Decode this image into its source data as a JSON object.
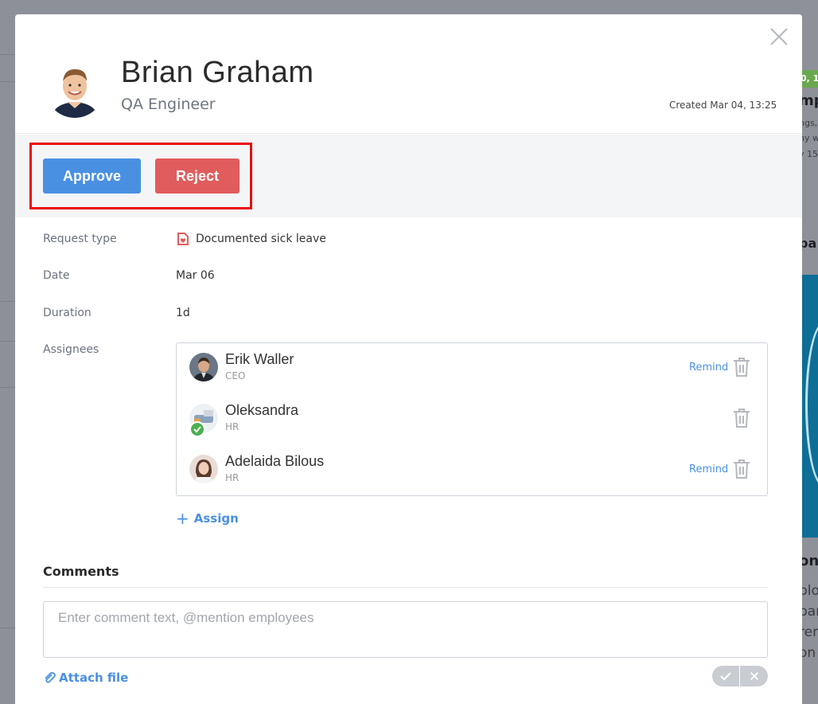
{
  "background": {
    "badge_text": "0, 1",
    "right_texts": [
      "mp",
      "ngs,",
      "ny w",
      "y 15",
      "pa",
      "on",
      "plo",
      "par",
      "ren",
      "on"
    ]
  },
  "profile": {
    "name": "Brian Graham",
    "title": "QA Engineer",
    "created": "Created Mar 04, 13:25"
  },
  "actions": {
    "approve_label": "Approve",
    "reject_label": "Reject"
  },
  "details": {
    "request_type_label": "Request type",
    "request_type_value": "Documented sick leave",
    "date_label": "Date",
    "date_value": "Mar 06",
    "duration_label": "Duration",
    "duration_value": "1d",
    "assignees_label": "Assignees"
  },
  "assignees": [
    {
      "name": "Erik Waller",
      "role": "CEO",
      "remind": "Remind"
    },
    {
      "name": "Oleksandra",
      "role": "HR",
      "remind": ""
    },
    {
      "name": "Adelaida Bilous",
      "role": "HR",
      "remind": "Remind"
    }
  ],
  "assign_label": "Assign",
  "comments": {
    "title": "Comments",
    "placeholder": "Enter comment text, @mention employees",
    "value": "",
    "attach_label": "Attach file"
  },
  "colors": {
    "approve": "#4a90e2",
    "reject": "#e15c5c",
    "link": "#4a90e2",
    "highlight": "#ea0a0a"
  }
}
